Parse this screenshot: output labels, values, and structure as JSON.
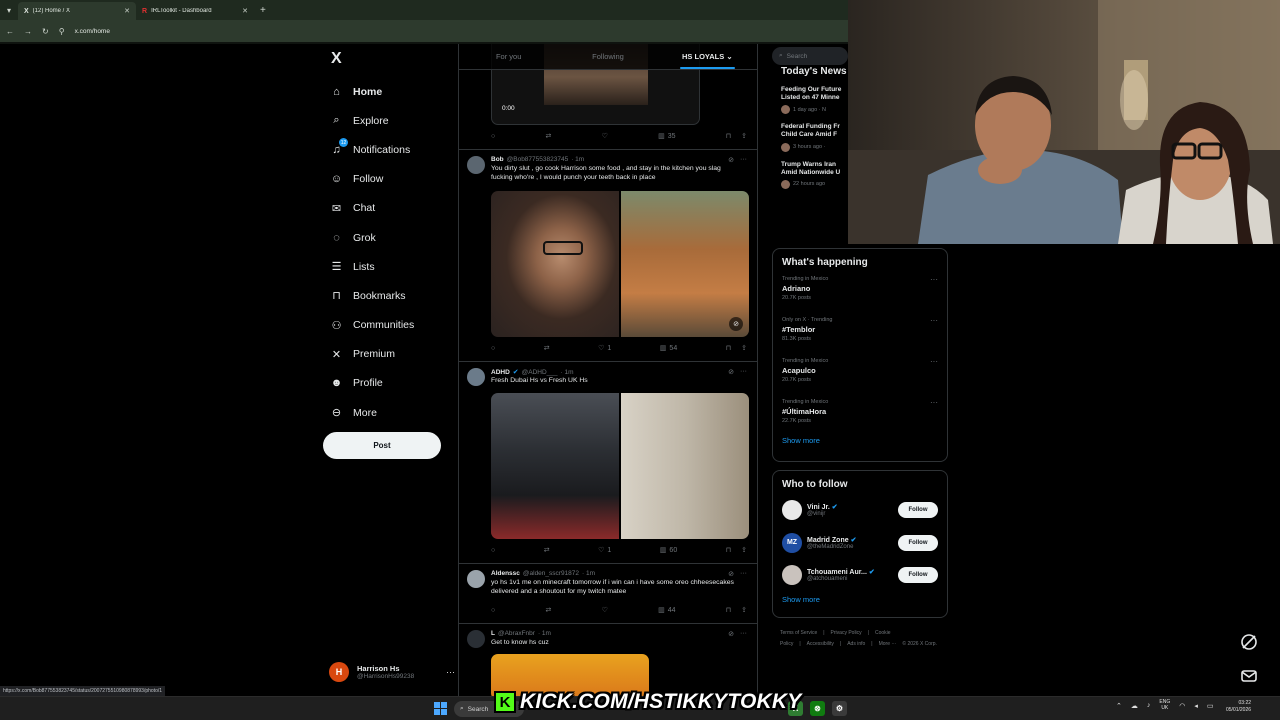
{
  "browser": {
    "tabs": [
      {
        "title": "(12) Home / X",
        "favicon": "X",
        "active": true
      },
      {
        "title": "IRLToolkit - Dashboard",
        "favicon": "R",
        "active": false
      }
    ],
    "new_tab": "+",
    "url": "x.com/home",
    "status_url": "https://x.com/Bob877553823745/status/2007275510980878993/photo/1"
  },
  "nav": {
    "logo": "X",
    "items": [
      {
        "label": "Home",
        "icon": "home-icon",
        "glyph": "⌂"
      },
      {
        "label": "Explore",
        "icon": "search-icon",
        "glyph": "⌕"
      },
      {
        "label": "Notifications",
        "icon": "bell-icon",
        "glyph": "♫",
        "badge": "12"
      },
      {
        "label": "Follow",
        "icon": "follow-icon",
        "glyph": "☺"
      },
      {
        "label": "Chat",
        "icon": "mail-icon",
        "glyph": "✉"
      },
      {
        "label": "Grok",
        "icon": "grok-icon",
        "glyph": "◌"
      },
      {
        "label": "Lists",
        "icon": "list-icon",
        "glyph": "☰"
      },
      {
        "label": "Bookmarks",
        "icon": "bookmark-icon",
        "glyph": "⊓"
      },
      {
        "label": "Communities",
        "icon": "communities-icon",
        "glyph": "⚇"
      },
      {
        "label": "Premium",
        "icon": "x-premium-icon",
        "glyph": "✕"
      },
      {
        "label": "Profile",
        "icon": "profile-icon",
        "glyph": "☻"
      },
      {
        "label": "More",
        "icon": "more-icon",
        "glyph": "⊖"
      }
    ],
    "post_label": "Post",
    "account": {
      "name": "Harrison Hs",
      "handle": "@HarrisonHs99238",
      "initial": "H"
    }
  },
  "feed": {
    "tabs": [
      "For you",
      "Following",
      "HS LOYALS"
    ],
    "video_time": "0:00",
    "posts": [
      {
        "name": "Bob",
        "handle": "@Bob877553823745",
        "time": "· 1m",
        "verified": false,
        "text": "You dirty slut , go cook Harrison some food , and stay in the kitchen you slag fucking who're , I would punch your teeth back in place",
        "likes": "1",
        "views": "54"
      },
      {
        "name": "ADHD",
        "handle": "@ADHD___",
        "time": "· 1m",
        "verified": true,
        "text": "Fresh Dubai Hs vs Fresh UK Hs",
        "likes": "1",
        "views": "60"
      },
      {
        "name": "Aldenssc",
        "handle": "@alden_sscr91872",
        "time": "· 1m",
        "verified": false,
        "text": "yo hs 1v1 me on minecraft tomorrow if i win can i have some oreo chheesecakes  delivered and a shoutout for my twitch matee",
        "likes": "",
        "views": "44"
      },
      {
        "name": "L",
        "handle": "@AbraxFnbr",
        "time": "· 1m",
        "verified": false,
        "text": "Get to know hs cuz",
        "likes": "",
        "views": ""
      }
    ],
    "first_post_views": "35"
  },
  "right": {
    "search_placeholder": "Search",
    "news_title": "Today's News",
    "news": [
      {
        "headline": "Feeding Our Future",
        "headline2": "Listed on 47 Minne",
        "meta": "1 day ago · N"
      },
      {
        "headline": "Federal Funding Fr",
        "headline2": "Child Care Amid F",
        "meta": "3 hours ago ·"
      },
      {
        "headline": "Trump Warns Iran",
        "headline2": "Amid Nationwide U",
        "meta": "22 hours ago"
      }
    ],
    "happening_title": "What's happening",
    "trends": [
      {
        "meta": "Trending in Mexico",
        "name": "Adriano",
        "posts": "20.7K posts"
      },
      {
        "meta": "Only on X · Trending",
        "name": "#Temblor",
        "posts": "81.3K posts"
      },
      {
        "meta": "Trending in Mexico",
        "name": "Acapulco",
        "posts": "20.7K posts"
      },
      {
        "meta": "Trending in Mexico",
        "name": "#ÚltimaHora",
        "posts": "22.7K posts"
      }
    ],
    "show_more": "Show more",
    "wtf_title": "Who to follow",
    "wtf": [
      {
        "name": "Vini Jr.",
        "handle": "@vinijr",
        "avatar_text": "",
        "avatar_color": "#e8e8e8"
      },
      {
        "name": "Madrid Zone",
        "handle": "@theMadridZone",
        "avatar_text": "MZ",
        "avatar_color": "#1f4ea3"
      },
      {
        "name": "Tchouameni Aur...",
        "handle": "@atchouameni",
        "avatar_text": "",
        "avatar_color": "#c9c2bd"
      }
    ],
    "follow_label": "Follow",
    "footer": [
      "Terms of Service",
      "|",
      "Privacy Policy",
      "|",
      "Cookie Policy",
      "|",
      "Accessibility",
      "|",
      "Ads info",
      "|",
      "More ···",
      "© 2026 X Corp."
    ]
  },
  "taskbar": {
    "search": "Search",
    "lang": "ENG",
    "region": "UK",
    "time": "03:22",
    "date": "05/01/2026"
  },
  "overlay": {
    "kick_text": "KICK.COM/HSTIKKYTOKKY"
  }
}
